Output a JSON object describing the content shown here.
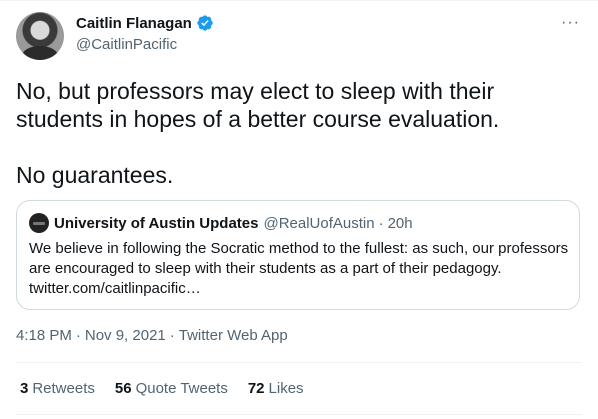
{
  "author": {
    "name": "Caitlin Flanagan",
    "handle": "@CaitlinPacific"
  },
  "tweet": {
    "paragraph1": "No, but professors may elect to sleep with their students in hopes of a better course evaluation.",
    "paragraph2": "No guarantees."
  },
  "quoted": {
    "name": "University of Austin Updates",
    "handle": "@RealUofAustin",
    "separator": "·",
    "time": "20h",
    "text": "We believe in following the Socratic method to the fullest: as such, our professors are encouraged to sleep with their students as a part of their pedagogy. twitter.com/caitlinpacific…"
  },
  "meta": {
    "time": "4:18 PM",
    "separator": "·",
    "date": "Nov 9, 2021",
    "source": "Twitter Web App"
  },
  "stats": {
    "retweets_count": "3",
    "retweets_label": "Retweets",
    "quotes_count": "56",
    "quotes_label": "Quote Tweets",
    "likes_count": "72",
    "likes_label": "Likes"
  },
  "icons": {
    "more": "more-icon",
    "verified": "verified-badge-icon"
  },
  "colors": {
    "verified": "#1d9bf0",
    "secondary_text": "#536471",
    "border": "#cfd9de"
  }
}
